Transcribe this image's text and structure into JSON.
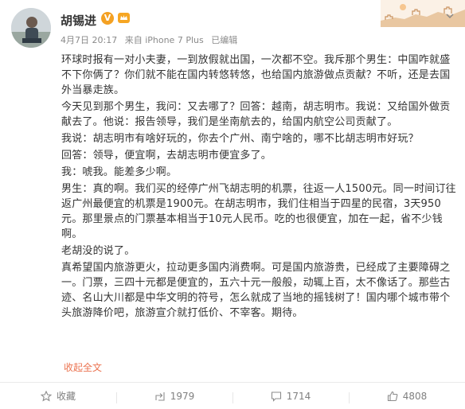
{
  "post": {
    "author": {
      "name": "胡锡进",
      "verified_badge": "V"
    },
    "meta": {
      "date": "4月7日 20:17",
      "source": "来自 iPhone 7 Plus",
      "edited": "已编辑"
    },
    "paragraphs": [
      "环球时报有一对小夫妻，一到放假就出国，一次都不空。我斥那个男生：中国咋就盛不下你俩了？你们就不能在国内转悠转悠，也给国内旅游做点贡献？不听，还是去国外当暴走族。",
      "今天见到那个男生，我问：又去哪了？回答：越南，胡志明市。我说：又给国外做贡献去了。他说：报告领导，我们是坐南航去的，给国内航空公司贡献了。",
      "我说：胡志明市有啥好玩的，你去个广州、南宁啥的，哪不比胡志明市好玩？",
      "回答：领导，便宜啊，去胡志明市便宜多了。",
      "我：唬我。能差多少啊。",
      "男生：真的啊。我们买的经停广州飞胡志明的机票，往返一人1500元。同一时间订往返广州最便宜的机票是1900元。在胡志明市，我们住相当于四星的民宿，3天950元。那里景点的门票基本相当于10元人民币。吃的也很便宜，加在一起，省不少钱啊。",
      "老胡没的说了。",
      "真希望国内旅游更火，拉动更多国内消费啊。可是国内旅游贵，已经成了主要障碍之一。门票，三四十元都是便宜的，五六十元一般般，动辄上百，太不像话了。那些古迹、名山大川都是中华文明的符号，怎么就成了当地的摇钱树了！国内哪个城市带个头旅游降价吧，旅游宣介就打低价、不宰客。期待。"
    ],
    "collapse_label": "收起全文",
    "actions": [
      {
        "icon": "star-icon",
        "label": "收藏"
      },
      {
        "icon": "share-icon",
        "label": "1979"
      },
      {
        "icon": "comment-icon",
        "label": "1714"
      },
      {
        "icon": "like-icon",
        "label": "4808"
      }
    ],
    "colors": {
      "accent_link": "#eb7350",
      "verified": "#f4a123",
      "meta_text": "#8a8a8a"
    }
  }
}
